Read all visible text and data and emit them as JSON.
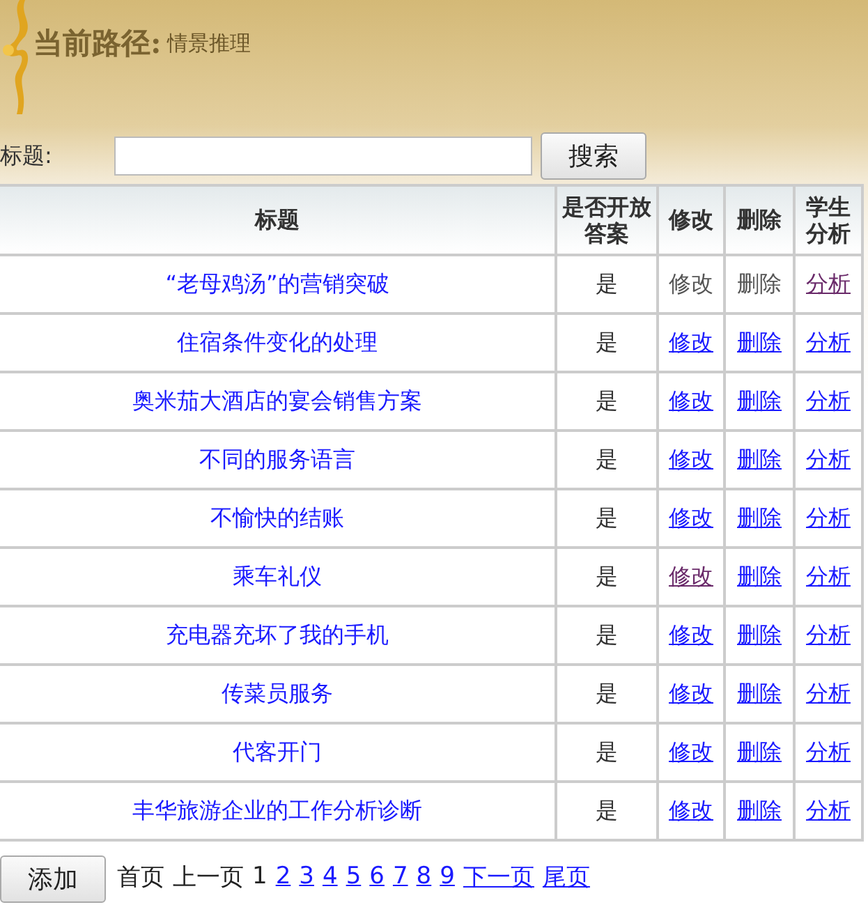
{
  "path": {
    "label": "当前路径:",
    "value": "情景推理"
  },
  "search": {
    "label": "标题:",
    "button": "搜索"
  },
  "table": {
    "columns": [
      "标题",
      "是否开放答案",
      "修改",
      "删除",
      "学生分析"
    ],
    "rows": [
      {
        "title": "“老母鸡汤”的营销突破",
        "open": "是",
        "edit": {
          "label": "修改",
          "kind": "text"
        },
        "delete": {
          "label": "删除",
          "kind": "text"
        },
        "analysis": {
          "label": "分析",
          "kind": "link",
          "visited": true
        }
      },
      {
        "title": "住宿条件变化的处理",
        "open": "是",
        "edit": {
          "label": "修改",
          "kind": "link",
          "visited": false
        },
        "delete": {
          "label": "删除",
          "kind": "link",
          "visited": false
        },
        "analysis": {
          "label": "分析",
          "kind": "link",
          "visited": false
        }
      },
      {
        "title": "奥米茄大酒店的宴会销售方案",
        "open": "是",
        "edit": {
          "label": "修改",
          "kind": "link",
          "visited": false
        },
        "delete": {
          "label": "删除",
          "kind": "link",
          "visited": false
        },
        "analysis": {
          "label": "分析",
          "kind": "link",
          "visited": false
        }
      },
      {
        "title": "不同的服务语言",
        "open": "是",
        "edit": {
          "label": "修改",
          "kind": "link",
          "visited": false
        },
        "delete": {
          "label": "删除",
          "kind": "link",
          "visited": false
        },
        "analysis": {
          "label": "分析",
          "kind": "link",
          "visited": false
        }
      },
      {
        "title": "不愉快的结账",
        "open": "是",
        "edit": {
          "label": "修改",
          "kind": "link",
          "visited": false
        },
        "delete": {
          "label": "删除",
          "kind": "link",
          "visited": false
        },
        "analysis": {
          "label": "分析",
          "kind": "link",
          "visited": false
        }
      },
      {
        "title": "乘车礼仪",
        "open": "是",
        "edit": {
          "label": "修改",
          "kind": "link",
          "visited": true
        },
        "delete": {
          "label": "删除",
          "kind": "link",
          "visited": false
        },
        "analysis": {
          "label": "分析",
          "kind": "link",
          "visited": false
        }
      },
      {
        "title": "充电器充坏了我的手机",
        "open": "是",
        "edit": {
          "label": "修改",
          "kind": "link",
          "visited": false
        },
        "delete": {
          "label": "删除",
          "kind": "link",
          "visited": false
        },
        "analysis": {
          "label": "分析",
          "kind": "link",
          "visited": false
        }
      },
      {
        "title": "传菜员服务",
        "open": "是",
        "edit": {
          "label": "修改",
          "kind": "link",
          "visited": false
        },
        "delete": {
          "label": "删除",
          "kind": "link",
          "visited": false
        },
        "analysis": {
          "label": "分析",
          "kind": "link",
          "visited": false
        }
      },
      {
        "title": "代客开门",
        "open": "是",
        "edit": {
          "label": "修改",
          "kind": "link",
          "visited": false
        },
        "delete": {
          "label": "删除",
          "kind": "link",
          "visited": false
        },
        "analysis": {
          "label": "分析",
          "kind": "link",
          "visited": false
        }
      },
      {
        "title": "丰华旅游企业的工作分析诊断",
        "open": "是",
        "edit": {
          "label": "修改",
          "kind": "link",
          "visited": false
        },
        "delete": {
          "label": "删除",
          "kind": "link",
          "visited": false
        },
        "analysis": {
          "label": "分析",
          "kind": "link",
          "visited": false
        }
      }
    ]
  },
  "footer": {
    "add_button": "添加",
    "pages": [
      {
        "label": "首页",
        "kind": "text"
      },
      {
        "label": "上一页",
        "kind": "text"
      },
      {
        "label": "1",
        "kind": "current"
      },
      {
        "label": "2",
        "kind": "link"
      },
      {
        "label": "3",
        "kind": "link"
      },
      {
        "label": "4",
        "kind": "link"
      },
      {
        "label": "5",
        "kind": "link"
      },
      {
        "label": "6",
        "kind": "link"
      },
      {
        "label": "7",
        "kind": "link"
      },
      {
        "label": "8",
        "kind": "link"
      },
      {
        "label": "9",
        "kind": "link"
      },
      {
        "label": "下一页",
        "kind": "link"
      },
      {
        "label": "尾页",
        "kind": "link"
      }
    ]
  }
}
